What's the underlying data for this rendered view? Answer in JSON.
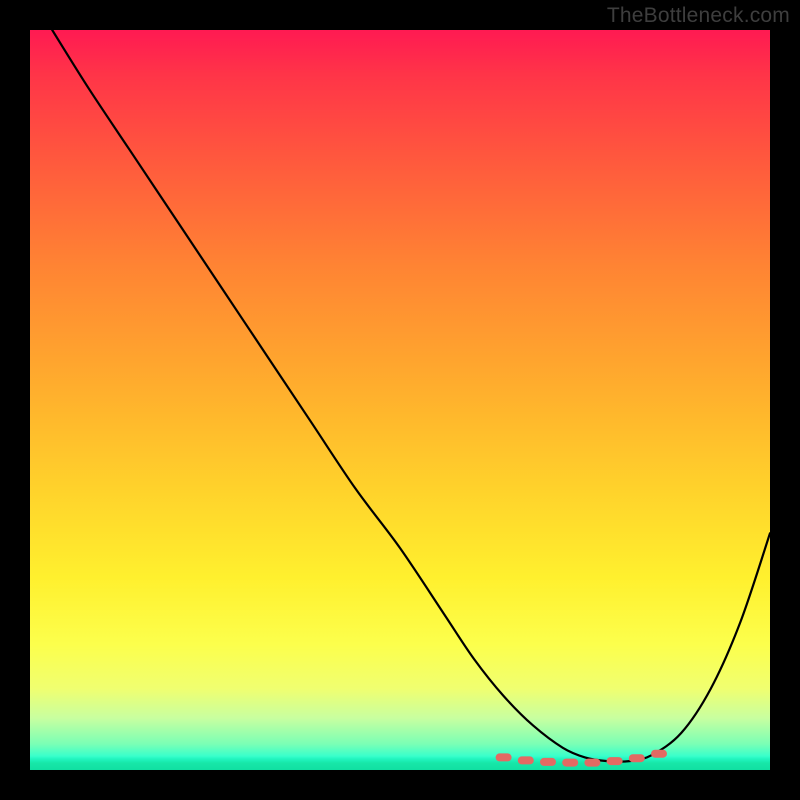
{
  "watermark": "TheBottleneck.com",
  "colors": {
    "frame": "#000000",
    "curve": "#000000",
    "marker": "#e36a63",
    "gradient_top": "#ff1a52",
    "gradient_bottom": "#0affde"
  },
  "chart_data": {
    "type": "line",
    "title": "",
    "xlabel": "",
    "ylabel": "",
    "xlim": [
      0,
      100
    ],
    "ylim": [
      0,
      100
    ],
    "grid": false,
    "legend": false,
    "series": [
      {
        "name": "bottleneck-curve",
        "x": [
          3,
          8,
          14,
          20,
          26,
          32,
          38,
          44,
          50,
          56,
          60,
          64,
          68,
          72,
          75,
          78,
          81,
          84,
          88,
          92,
          96,
          100
        ],
        "values": [
          100,
          92,
          83,
          74,
          65,
          56,
          47,
          38,
          30,
          21,
          15,
          10,
          6,
          3,
          1.7,
          1.2,
          1.2,
          2,
          5,
          11,
          20,
          32
        ]
      }
    ],
    "markers": [
      {
        "x": 64,
        "y": 1.7
      },
      {
        "x": 67,
        "y": 1.3
      },
      {
        "x": 70,
        "y": 1.1
      },
      {
        "x": 73,
        "y": 1.0
      },
      {
        "x": 76,
        "y": 1.0
      },
      {
        "x": 79,
        "y": 1.2
      },
      {
        "x": 82,
        "y": 1.6
      },
      {
        "x": 85,
        "y": 2.2
      }
    ],
    "annotations": [],
    "background_gradient": {
      "direction": "vertical",
      "stops": [
        {
          "pos": 0.0,
          "color": "#ff1a52"
        },
        {
          "pos": 0.18,
          "color": "#ff5a3d"
        },
        {
          "pos": 0.48,
          "color": "#ffad2d"
        },
        {
          "pos": 0.74,
          "color": "#fff02e"
        },
        {
          "pos": 0.93,
          "color": "#c8ffa0"
        },
        {
          "pos": 1.0,
          "color": "#0affde"
        }
      ]
    }
  }
}
